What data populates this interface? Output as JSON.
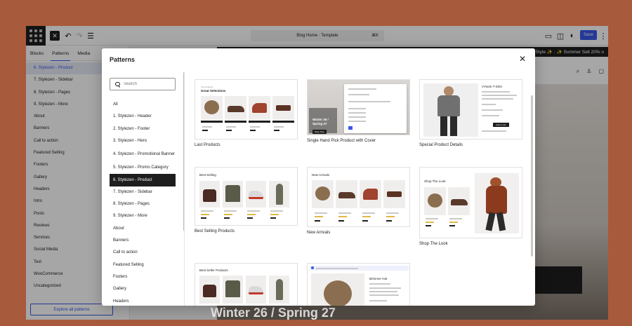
{
  "editor": {
    "document_title": "Blog Home · Template",
    "document_shortcut": "⌘K",
    "save_label": "Save",
    "icons": [
      "close-icon",
      "undo-icon",
      "redo-icon",
      "list-view-icon",
      "desktop-preview-icon",
      "sidebar-toggle-icon",
      "style-contrast-icon",
      "more-options-icon"
    ]
  },
  "inserter": {
    "tabs": [
      "Blocks",
      "Patterns",
      "Media"
    ],
    "active_tab": "Patterns",
    "items": [
      "6. Stylezen - Product",
      "7. Stylezen - Sidebar",
      "8. Stylezen - Pages",
      "9. Stylezen - More",
      "About",
      "Banners",
      "Call to action",
      "Featured Selling",
      "Footers",
      "Gallery",
      "Headers",
      "Intro",
      "Posts",
      "Reviews",
      "Services",
      "Social Media",
      "Text",
      "WooCommerce",
      "Uncategorized"
    ],
    "explore_label": "Explore all patterns"
  },
  "preview": {
    "announcement": "ur Style ✨ · ✨ Summer Sell 20% o",
    "hero_caption": "Winter 26 / Spring 27"
  },
  "modal": {
    "title": "Patterns",
    "search_placeholder": "Search",
    "categories": [
      "All",
      "1. Stylezen - Header",
      "2. Stylezen - Footer",
      "3. Stylezen - Hero",
      "4. Stylezen - Promotional Banner",
      "5. Stylezen - Promo Category",
      "6. Stylezen - Product",
      "7. Stylezen - Sidebar",
      "8. Stylezen - Pages",
      "9. Stylezen - More",
      "About",
      "Banners",
      "Call to action",
      "Featured Selling",
      "Footers",
      "Gallery",
      "Headers"
    ],
    "active_category": "6. Stylezen - Product",
    "patterns": [
      {
        "label": "Last Products",
        "eyebrow": "Top products",
        "heading": "Great Selections"
      },
      {
        "label": "Single Hand Pick Product with Cover",
        "heading": "Winter 26 / Spring 27",
        "button": "Shop Now"
      },
      {
        "label": "Special Product Details",
        "heading": "V-Neck T-Shirt",
        "button": "Add to cart"
      },
      {
        "label": "Best Selling Products",
        "heading": "Best Selling"
      },
      {
        "label": "New Arrivals",
        "heading": "New Arrivals"
      },
      {
        "label": "Shop The Look",
        "heading": "Shop The Look"
      },
      {
        "label": "",
        "heading": "Best Seller Products"
      },
      {
        "label": "",
        "heading": "Brimmer Hat"
      }
    ]
  },
  "colors": {
    "accent": "#3858e9",
    "background": "#a85a3c",
    "active_category_bg": "#1e1e1e"
  }
}
